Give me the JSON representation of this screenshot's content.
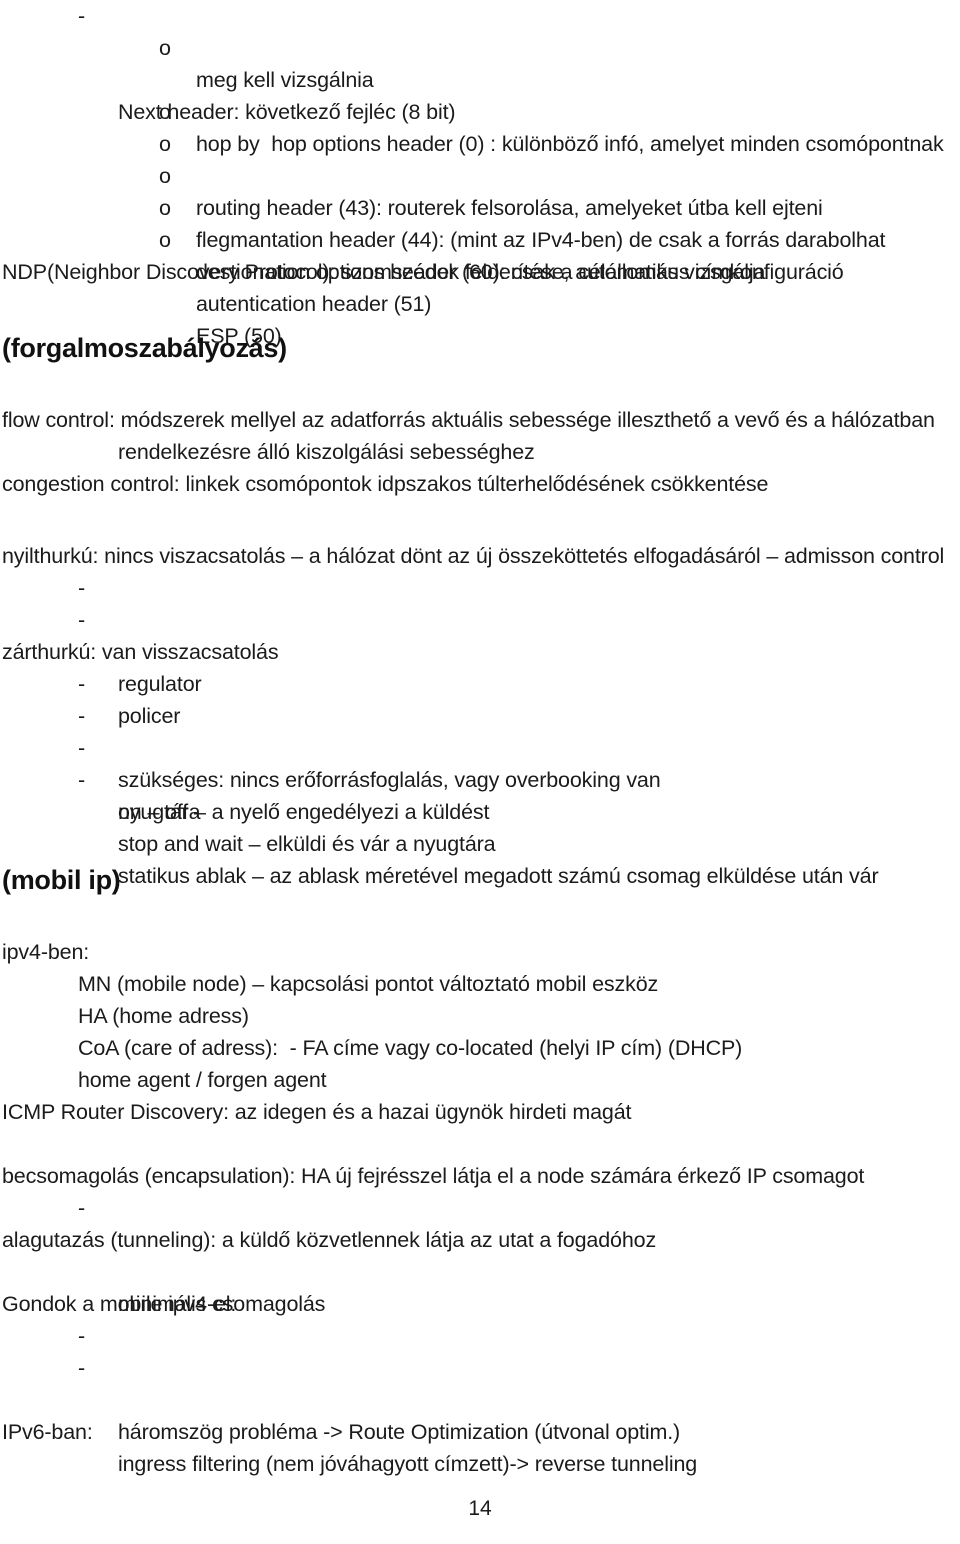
{
  "document": {
    "page_number": "14",
    "background_color": "#ffffff",
    "text_color": "#1b1b1b",
    "markers": {
      "dash": "-",
      "circle": "o"
    }
  },
  "blocks": {
    "next_header": {
      "title": "Next header: következő fejléc (8 bit)",
      "items": [
        "hop by  hop options header (0) : különböző infó, amelyet minden csomópontnak",
        "meg kell vizsgálnia",
        "routing header (43): routerek felsorolása, amelyeket útba kell ejteni",
        "flegmantation header (44): (mint az IPv4-ben) de csak a forrás darabolhat",
        "destionation options header (60): csak a célállomás vizsgálja",
        "autentication header (51)",
        "ESP (50)"
      ]
    },
    "ndp_line": "NDP(Neighbor Discovery Protocol): szomszédok felderítése, automatikus címkonfiguráció",
    "traffic_control": {
      "heading": "(forgalmoszabályozás)",
      "flow_control_line1": "flow control: módszerek mellyel az adatforrás aktuális sebessége illeszthető a vevő és a hálózatban",
      "flow_control_line2": "rendelkezésre álló kiszolgálási sebességhez",
      "congestion_control": "congestion control: linkek csomópontok idpszakos túlterhelődésének csökkentése",
      "open_loop": "nyilthurkú: nincs viszacsatolás – a hálózat dönt az új összeköttetés elfogadásáról – admisson control",
      "open_loop_items": [
        "regulator",
        "policer"
      ],
      "closed_loop": "zárthurkú: van visszacsatolás",
      "closed_loop_items": [
        "szükséges: nincs erőforrásfoglalás, vagy overbooking van",
        "on – off – a nyelő engedélyezi a küldést",
        "stop and wait – elküldi és vár a nyugtára",
        "statikus ablak – az ablask méretével megadott számú csomag elküldése után vár"
      ],
      "closed_loop_last_wrap": "nyugtára"
    },
    "mobile_ip": {
      "heading": "(mobil ip)",
      "ipv4_label": "ipv4-ben:",
      "ipv4_items": [
        "MN (mobile node) – kapcsolási pontot változtató mobil eszköz",
        "HA (home adress)",
        "CoA (care of adress):  - FA címe vagy co-located (helyi IP cím) (DHCP)",
        "home agent / forgen agent"
      ],
      "icmp_router_discovery": "ICMP Router Discovery: az idegen és a hazai ügynök hirdeti magát",
      "encapsulation": "becsomagolás (encapsulation): HA új fejrésszel látja el a node számára érkező IP csomagot",
      "encapsulation_item": "minimális csomagolás",
      "tunneling": "alagutazás (tunneling): a küldő közvetlennek látja az utat a fogadóhoz",
      "problems_label": "Gondok a mobile ipv4-el:",
      "problems_items": [
        "háromszög probléma -> Route Optimization (útvonal optim.)",
        "ingress filtering (nem jóváhagyott címzett)-> reverse tunneling"
      ],
      "ipv6_label": "IPv6-ban:"
    }
  }
}
